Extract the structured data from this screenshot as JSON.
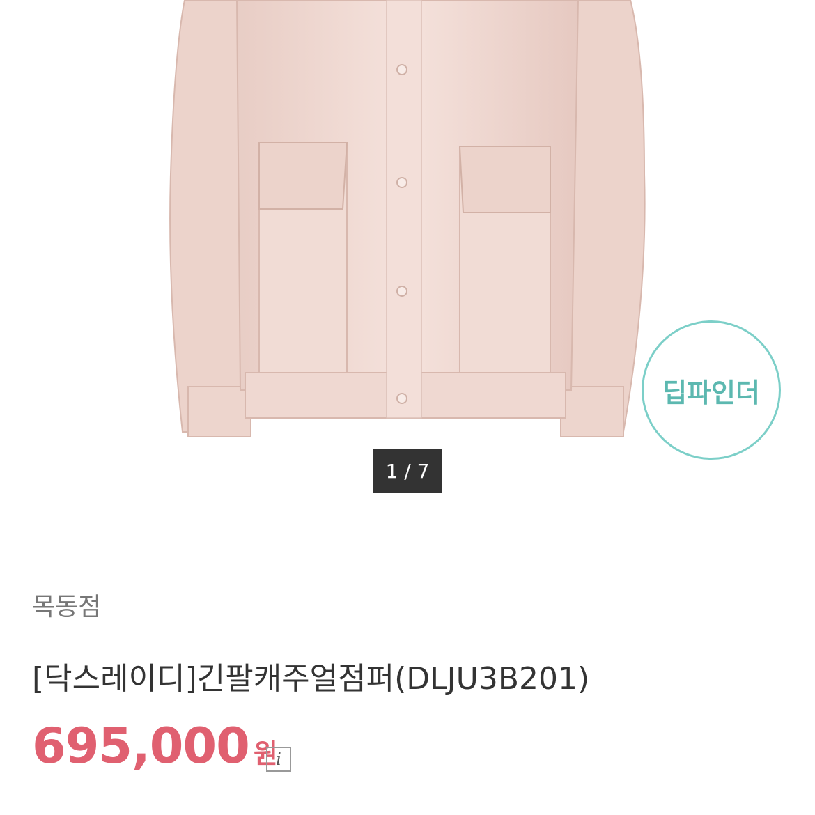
{
  "gallery": {
    "page_indicator": "1 / 7",
    "badge_text": "딥파인더"
  },
  "product": {
    "store": "목동점",
    "title": "[닥스레이디]긴팔캐주얼점퍼(DLJU3B201)",
    "price": "695,000",
    "price_unit": "원",
    "info_icon_glyph": "i"
  },
  "colors": {
    "price": "#e06070",
    "badge": "#7ccfc8",
    "indicator_bg": "#333333",
    "jacket": "#f2d9d2"
  }
}
